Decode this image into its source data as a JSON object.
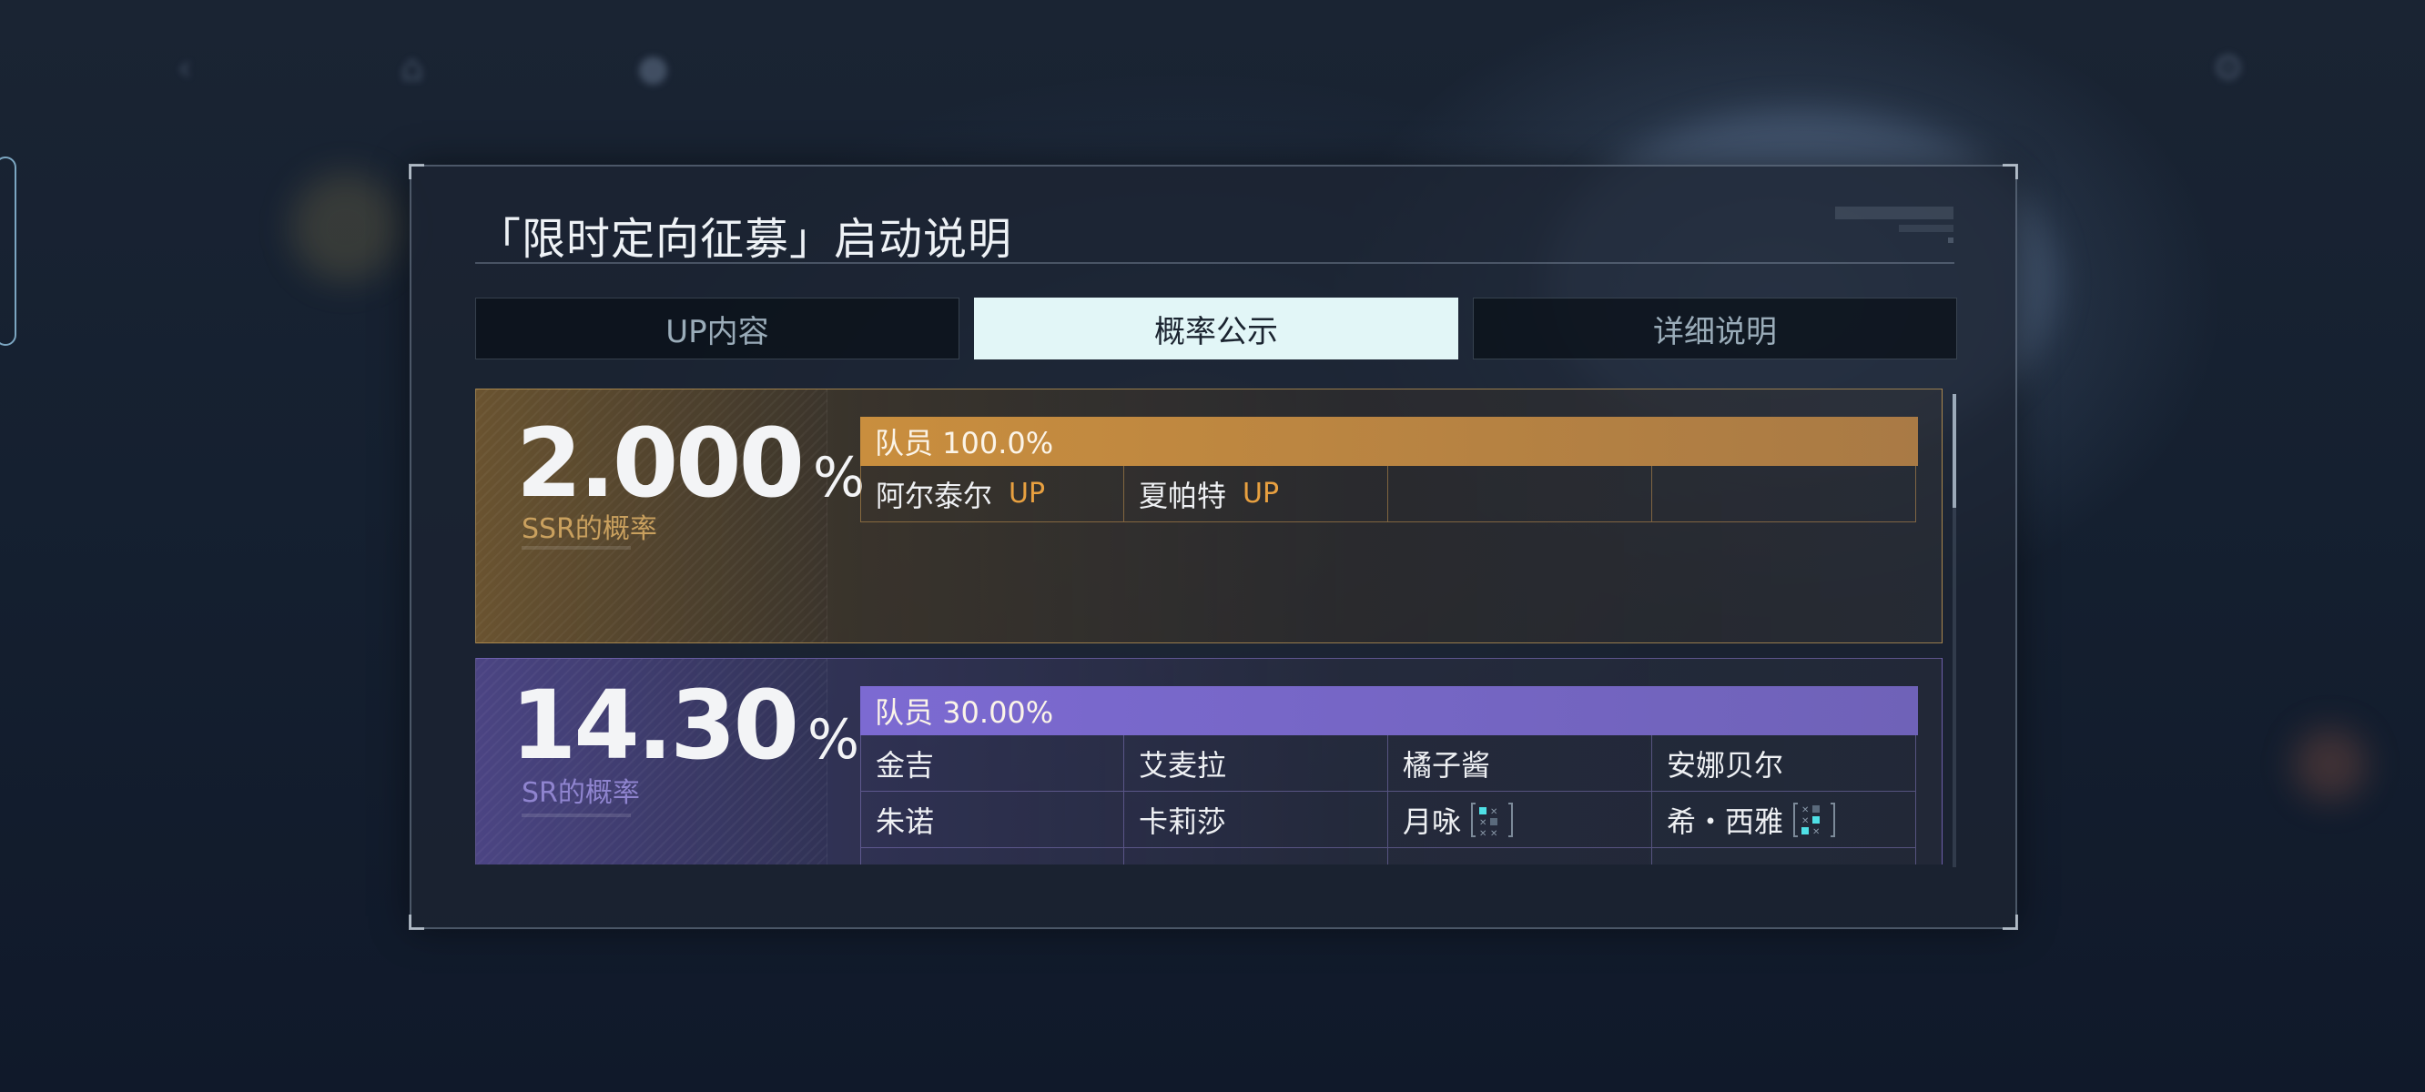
{
  "dialog": {
    "title": "「限时定向征募」启动说明"
  },
  "tabs": [
    {
      "label": "UP内容",
      "active": false
    },
    {
      "label": "概率公示",
      "active": true
    },
    {
      "label": "详细说明",
      "active": false
    }
  ],
  "ssr": {
    "rate_number": "2.000",
    "rate_unit": "%",
    "rate_label": "SSR的概率",
    "group_header": "队员 100.0%",
    "members": [
      {
        "name": "阿尔泰尔",
        "tag": "UP"
      },
      {
        "name": "夏帕特",
        "tag": "UP"
      },
      {
        "name": "",
        "tag": ""
      },
      {
        "name": "",
        "tag": ""
      }
    ]
  },
  "sr": {
    "rate_number": "14.30",
    "rate_unit": "%",
    "rate_label": "SR的概率",
    "group_header": "队员 30.00%",
    "rows": [
      [
        {
          "name": "金吉"
        },
        {
          "name": "艾麦拉"
        },
        {
          "name": "橘子酱"
        },
        {
          "name": "安娜贝尔"
        }
      ],
      [
        {
          "name": "朱诺"
        },
        {
          "name": "卡莉莎"
        },
        {
          "name": "月咏",
          "icon": "element-grid-icon"
        },
        {
          "name": "希・西雅",
          "icon": "element-grid-icon"
        }
      ]
    ]
  },
  "colors": {
    "ssr_accent": "#c98e3e",
    "sr_accent": "#7c6ad2",
    "tab_active_bg": "#e2f6f7",
    "up_tag": "#e8a040"
  }
}
